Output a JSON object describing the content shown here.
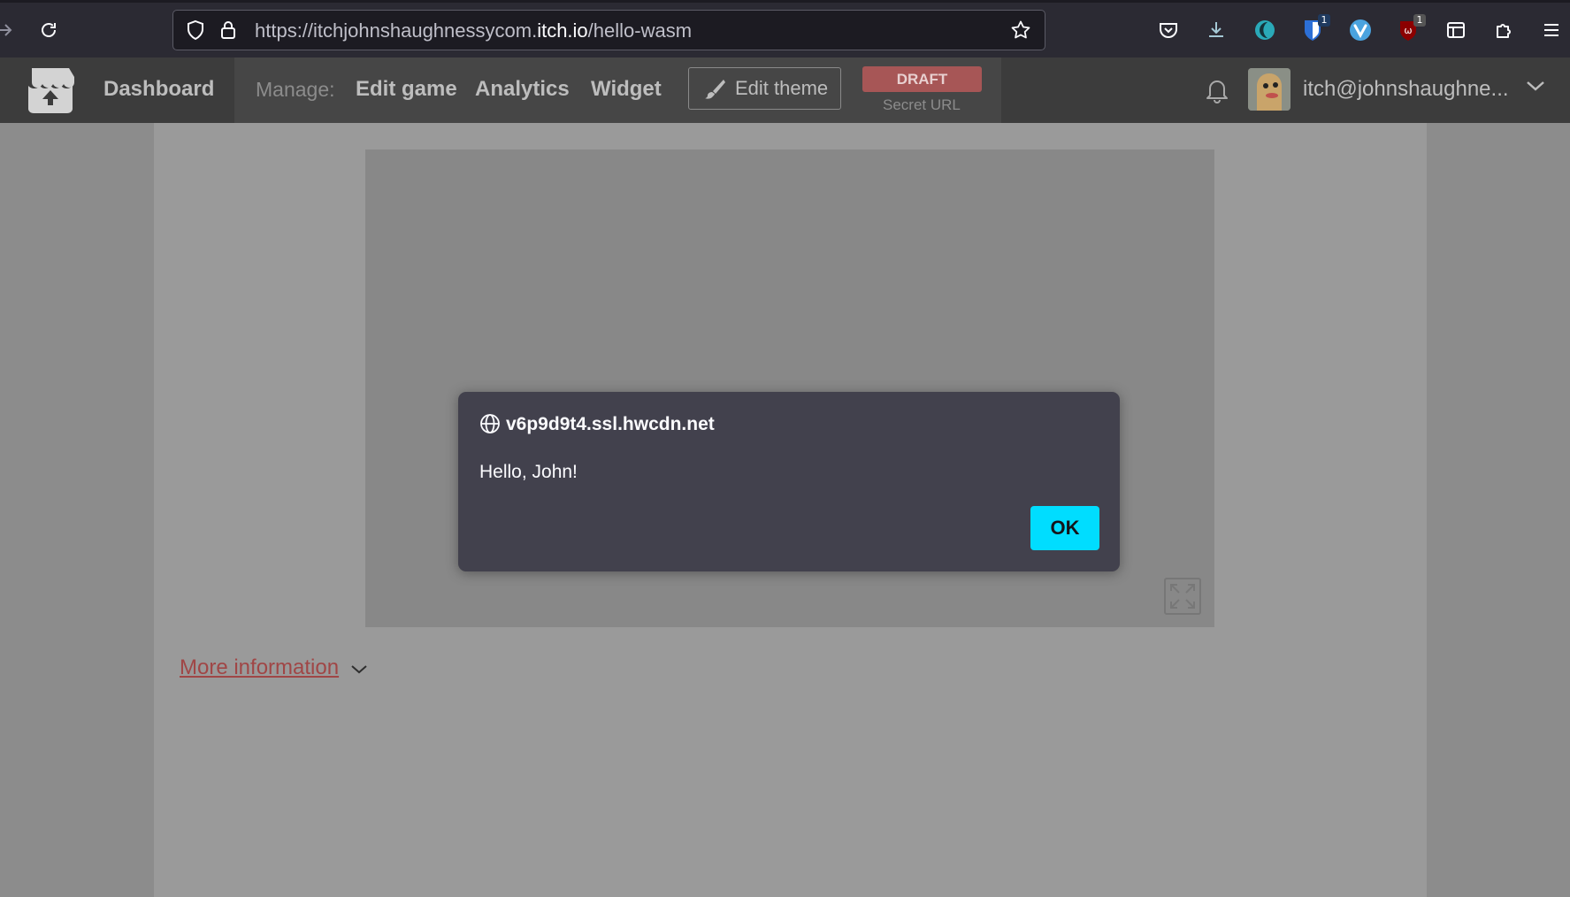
{
  "browser": {
    "url_prefix": "https://itchjohnshaughnessycom.",
    "url_domain": "itch.io",
    "url_path": "/hello-wasm",
    "extension_badges": [
      "1",
      "1"
    ],
    "icons": [
      "back-arrow-icon",
      "reload-icon",
      "shield-icon",
      "lock-icon",
      "bookmark-star-icon",
      "pocket-icon",
      "download-icon",
      "moon-extension-icon",
      "bitwarden-icon",
      "vivaldi-extension-icon",
      "ublock-icon",
      "container-icon",
      "extensions-puzzle-icon",
      "menu-icon"
    ]
  },
  "itch_header": {
    "dashboard_label": "Dashboard",
    "manage_label": "Manage:",
    "nav": {
      "edit_game": "Edit game",
      "analytics": "Analytics",
      "widget": "Widget"
    },
    "edit_theme_label": "Edit theme",
    "draft_label": "DRAFT",
    "secret_url_label": "Secret URL",
    "user_name": "itch@johnshaughne..."
  },
  "page": {
    "more_information_label": "More information"
  },
  "dialog": {
    "origin": "v6p9d9t4.ssl.hwcdn.net",
    "message": "Hello, John!",
    "ok_label": "OK"
  },
  "colors": {
    "accent_button": "#00ddff",
    "draft_badge": "#a75656",
    "link": "#a04646"
  }
}
